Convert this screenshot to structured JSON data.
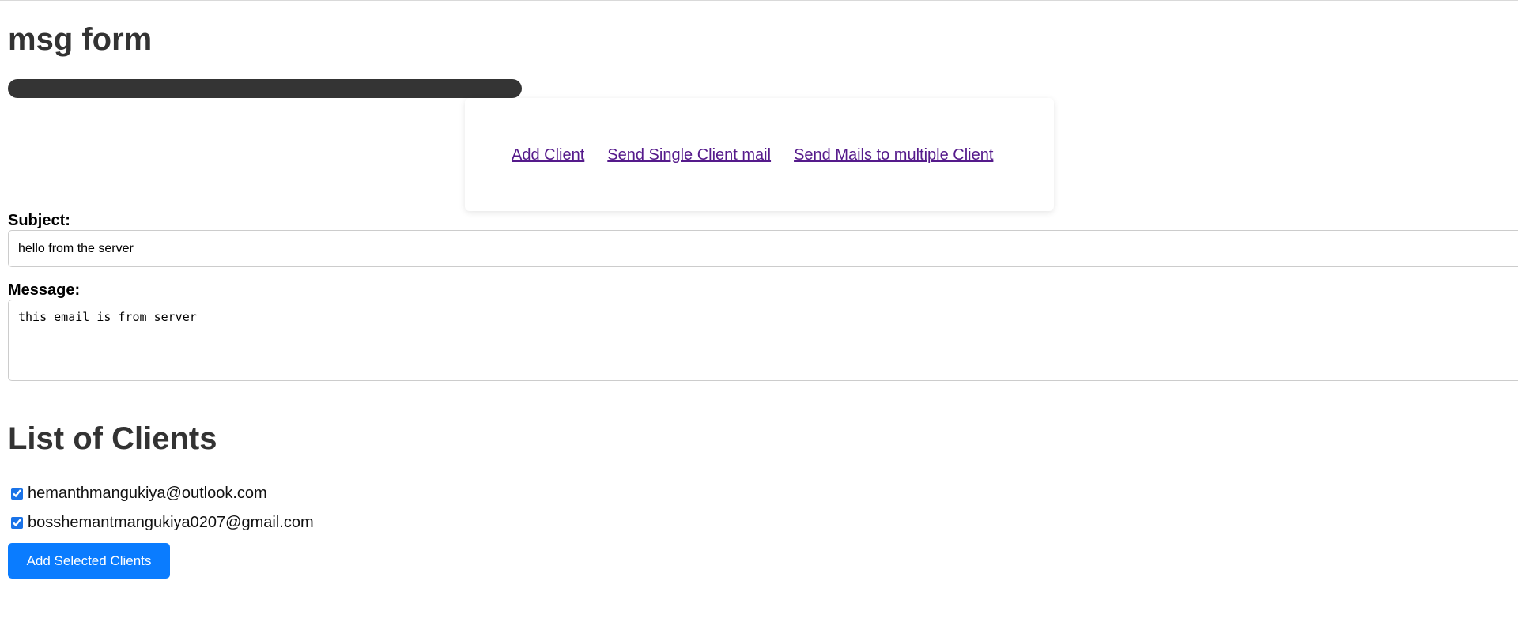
{
  "page": {
    "title": "msg form"
  },
  "nav": {
    "links": [
      {
        "label": "Add Client"
      },
      {
        "label": "Send Single Client mail"
      },
      {
        "label": "Send Mails to multiple Client"
      }
    ]
  },
  "form": {
    "subject_label": "Subject:",
    "subject_value": "hello from the server",
    "message_label": "Message:",
    "message_value": "this email is from server"
  },
  "clients": {
    "heading": "List of Clients",
    "items": [
      {
        "email": "hemanthmangukiya@outlook.com",
        "checked": true
      },
      {
        "email": "bosshemantmangukiya0207@gmail.com",
        "checked": true
      }
    ],
    "button_label": "Add Selected Clients"
  },
  "colors": {
    "link": "#551a8b",
    "button": "#0a7cff",
    "bar": "#343434",
    "heading": "#333333"
  }
}
